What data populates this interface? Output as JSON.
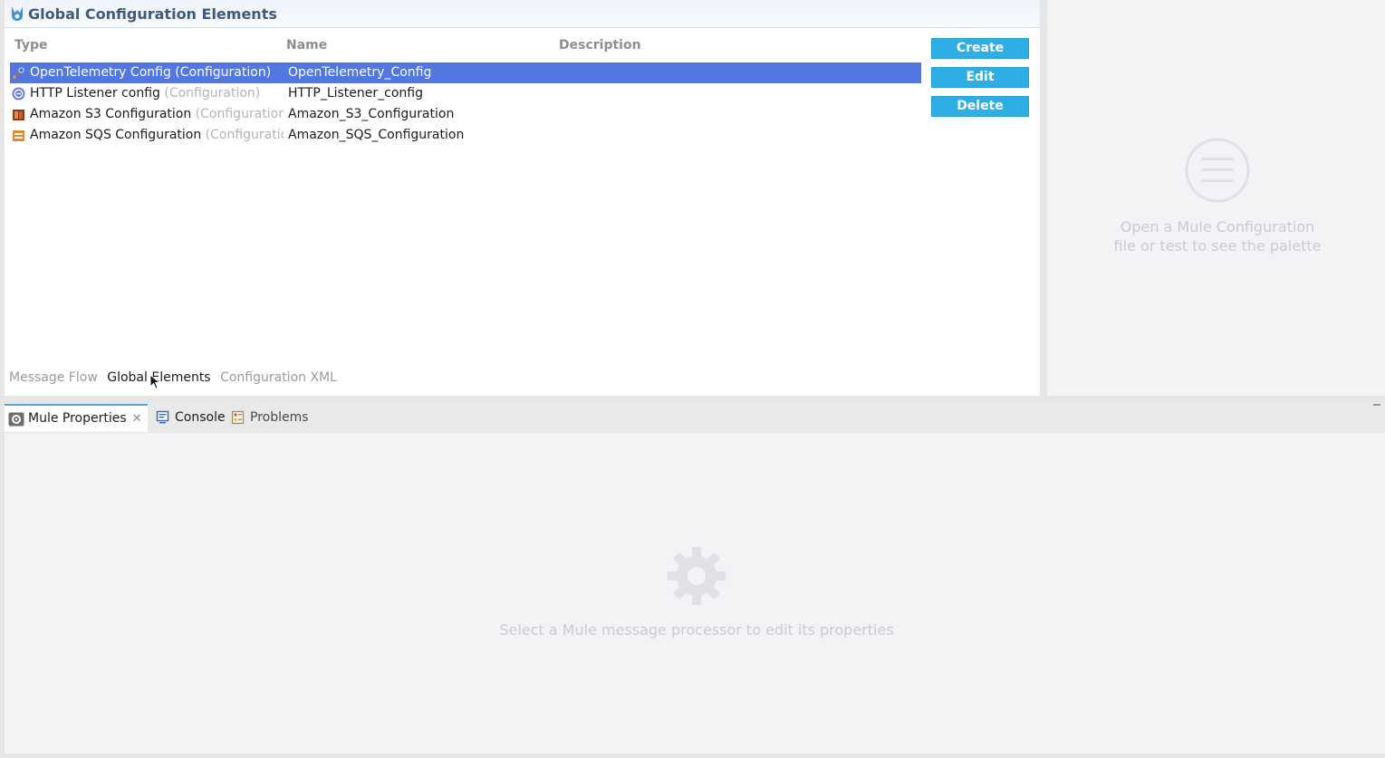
{
  "editor": {
    "title": "Global Configuration Elements",
    "columns": {
      "type": "Type",
      "name": "Name",
      "description": "Description"
    },
    "rows": [
      {
        "type": "OpenTelemetry Config",
        "kind": "(Configuration)",
        "name": "OpenTelemetry_Config",
        "selected": true,
        "icon": "opentelemetry-icon"
      },
      {
        "type": "HTTP Listener config",
        "kind": "(Configuration)",
        "name": "HTTP_Listener_config",
        "selected": false,
        "icon": "http-listener-icon"
      },
      {
        "type": "Amazon S3 Configuration",
        "kind": "(Configuration)",
        "name": "Amazon_S3_Configuration",
        "selected": false,
        "icon": "amazon-s3-icon"
      },
      {
        "type": "Amazon SQS Configuration",
        "kind": "(Configuration",
        "name": "Amazon_SQS_Configuration",
        "selected": false,
        "icon": "amazon-sqs-icon"
      }
    ],
    "buttons": {
      "create": "Create",
      "edit": "Edit",
      "delete": "Delete"
    },
    "sub_tabs": {
      "message_flow": "Message Flow",
      "global_elements": "Global Elements",
      "configuration_xml": "Configuration XML"
    },
    "active_sub_tab": "global_elements"
  },
  "palette": {
    "placeholder_line1": "Open a Mule Configuration",
    "placeholder_line2": "file or test to see the palette"
  },
  "bottom_panel": {
    "tabs": {
      "mule_properties": "Mule Properties",
      "console": "Console",
      "problems": "Problems"
    },
    "active_tab": "mule_properties",
    "placeholder": "Select a Mule message processor to edit its properties"
  },
  "colors": {
    "accent_button": "#2eaee3",
    "selection": "#5178e1",
    "header_title": "#3f5a7a"
  }
}
